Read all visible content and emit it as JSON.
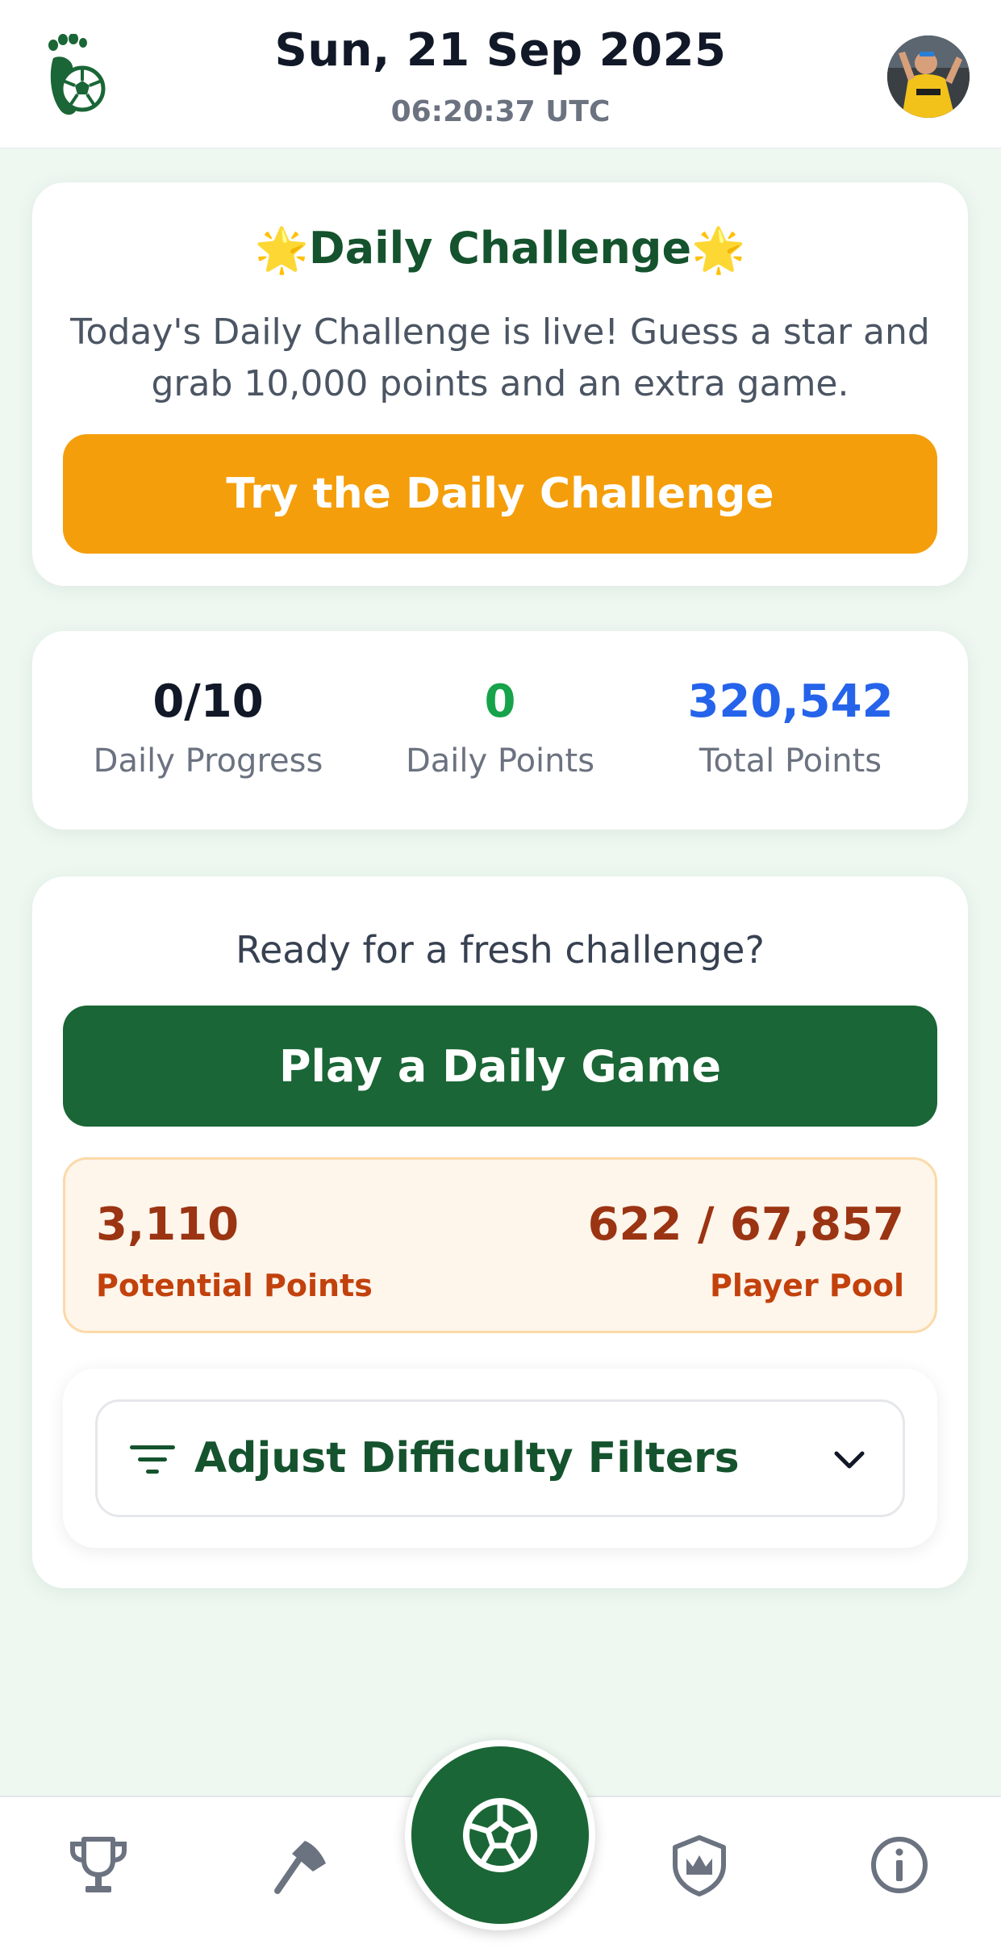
{
  "header": {
    "date": "Sun, 21 Sep 2025",
    "time": "06:20:37 UTC",
    "logo_icon": "footprint-ball-icon",
    "avatar_icon": "user-avatar"
  },
  "daily_challenge": {
    "star_left": "🌟",
    "title": "Daily Challenge",
    "star_right": "🌟",
    "description": "Today's Daily Challenge is live! Guess a star and grab 10,000 points and an extra game.",
    "button_label": "Try the Daily Challenge",
    "button_color": "#f59e0b"
  },
  "stats": {
    "daily_progress": {
      "value": "0/10",
      "label": "Daily Progress",
      "color": "#111827"
    },
    "daily_points": {
      "value": "0",
      "label": "Daily Points",
      "color": "#16a34a"
    },
    "total_points": {
      "value": "320,542",
      "label": "Total Points",
      "color": "#2563eb"
    }
  },
  "game": {
    "prompt": "Ready for a fresh challenge?",
    "play_button_label": "Play a Daily Game",
    "play_button_color": "#1a6636",
    "potential_points_value": "3,110",
    "potential_points_label": "Potential Points",
    "player_pool_value": "622 / 67,857",
    "player_pool_label": "Player Pool",
    "filters_label": "Adjust Difficulty Filters",
    "filters_icon": "filter-icon",
    "filters_chevron": "chevron-down-icon"
  },
  "nav": {
    "items": [
      {
        "icon": "trophy-icon"
      },
      {
        "icon": "axe-icon"
      },
      {
        "icon": "soccer-ball-icon"
      },
      {
        "icon": "shield-crown-icon"
      },
      {
        "icon": "info-icon"
      }
    ]
  }
}
